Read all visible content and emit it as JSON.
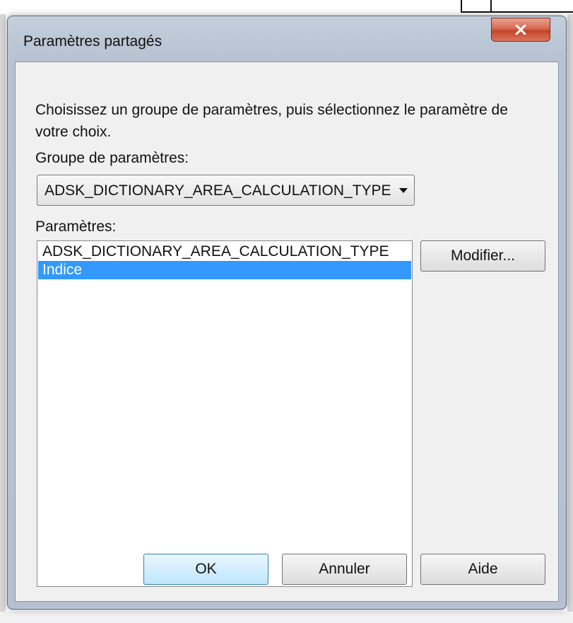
{
  "window": {
    "title": "Paramètres partagés"
  },
  "dialog": {
    "instruction": "Choisissez un groupe de paramètres, puis sélectionnez le paramètre de votre choix.",
    "group_label": "Groupe de paramètres:",
    "group_selected": "ADSK_DICTIONARY_AREA_CALCULATION_TYPE",
    "params_label": "Paramètres:",
    "params": [
      {
        "label": "ADSK_DICTIONARY_AREA_CALCULATION_TYPE",
        "selected": false
      },
      {
        "label": "Indice",
        "selected": true
      }
    ]
  },
  "buttons": {
    "modify": "Modifier...",
    "ok": "OK",
    "cancel": "Annuler",
    "help": "Aide"
  },
  "colors": {
    "selection": "#3399ff",
    "close_button": "#c4452b",
    "default_button": "#bee6fd"
  },
  "icons": {
    "close": "close-icon",
    "dropdown": "chevron-down-icon"
  }
}
